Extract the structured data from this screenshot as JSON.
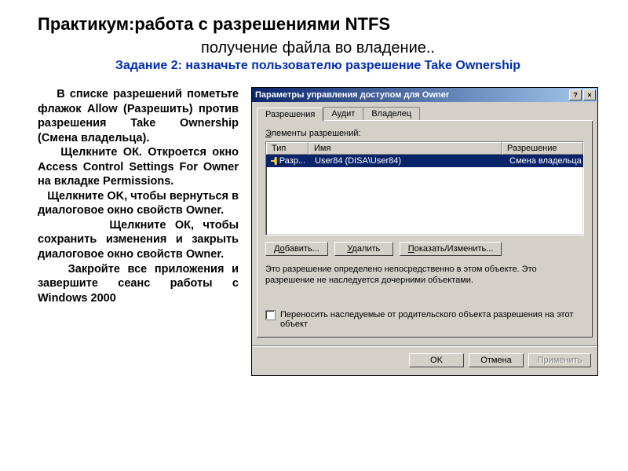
{
  "slide": {
    "title": "Практикум:работа с разрешениями NTFS",
    "subtitle": "получение файла во владение..",
    "task": "Задание 2: назначьте пользователю разрешение Take Ownership",
    "body_html": "&nbsp;&nbsp;&nbsp;&nbsp;В списке разрешений пометьте флажок Allow (Разрешить) против разрешения Take Ownership (Смена владельца).<br>&nbsp;&nbsp;&nbsp;&nbsp;Щелкните ОК. Откроется окно Access Control Settings For Owner на вкладке Permissions.<br>&nbsp;&nbsp;&nbsp;Щелкните OK, чтобы вернуться в диалоговое окно свойств Owner.<br>&nbsp;&nbsp;&nbsp;&nbsp;&nbsp;&nbsp;&nbsp;&nbsp;Щелкните ОК, чтобы сохранить изменения и закрыть диалоговое окно свойств Owner.<br>&nbsp;&nbsp;&nbsp;&nbsp;Закройте все приложения и завершите сеанс работы с Windows 2000"
  },
  "dialog": {
    "title": "Параметры управления доступом для Owner",
    "help_glyph": "?",
    "close_glyph": "×",
    "tabs": {
      "perm": "Разрешения",
      "audit": "Аудит",
      "owner": "Владелец"
    },
    "list_label": "Элементы разрешений:",
    "columns": {
      "type": "Тип",
      "name": "Имя",
      "perm": "Разрешение"
    },
    "row": {
      "type": "Разр...",
      "name": "User84 (DISA\\User84)",
      "perm": "Смена владельца"
    },
    "buttons": {
      "add": "Добавить...",
      "remove": "Удалить",
      "viewedit": "Показать/Изменить..."
    },
    "note": "Это разрешение определено непосредственно в этом объекте. Это разрешение не наследуется дочерними объектами.",
    "inherit_checkbox": "Переносить наследуемые от родительского объекта разрешения на этот объект",
    "footer": {
      "ok": "OK",
      "cancel": "Отмена",
      "apply": "Применить"
    }
  }
}
